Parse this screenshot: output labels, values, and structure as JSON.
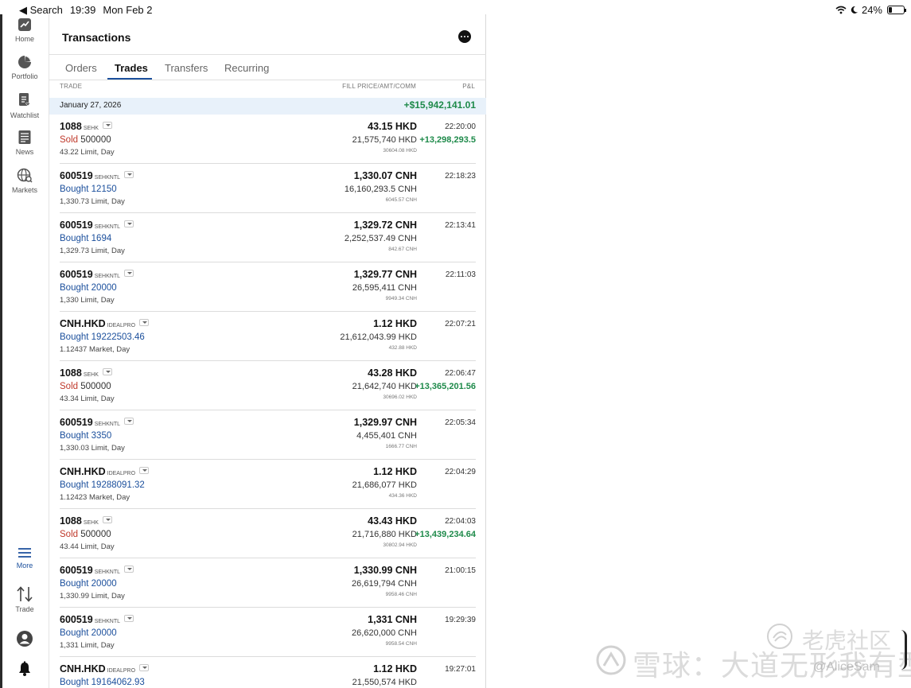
{
  "status_bar": {
    "back_label": "◀ Search",
    "time": "19:39",
    "date": "Mon Feb 2",
    "battery_text": "24%",
    "battery_level": 0.24
  },
  "sidebar": {
    "items": [
      {
        "label": "Home",
        "icon": "chart-trend-icon"
      },
      {
        "label": "Portfolio",
        "icon": "pie-chart-icon"
      },
      {
        "label": "Watchlist",
        "icon": "watchlist-icon"
      },
      {
        "label": "News",
        "icon": "news-icon"
      },
      {
        "label": "Markets",
        "icon": "globe-icon"
      }
    ],
    "bottom": [
      {
        "label": "More",
        "icon": "menu-icon"
      },
      {
        "label": "Trade",
        "icon": "trade-arrows-icon"
      },
      {
        "label": "",
        "icon": "account-icon"
      },
      {
        "label": "",
        "icon": "bell-icon"
      }
    ]
  },
  "header": {
    "title": "Transactions",
    "more_icon": "ellipsis-icon"
  },
  "tabs": [
    {
      "label": "Orders",
      "active": false
    },
    {
      "label": "Trades",
      "active": true
    },
    {
      "label": "Transfers",
      "active": false
    },
    {
      "label": "Recurring",
      "active": false
    }
  ],
  "columns": {
    "trade": "TRADE",
    "fill": "FILL PRICE/AMT/COMM",
    "pnl": "P&L"
  },
  "day_group": {
    "date": "January 27, 2026",
    "pnl": "+$15,942,141.01"
  },
  "trades": [
    {
      "symbol": "1088",
      "exchange": "SEHK",
      "action": "Sold",
      "qty": "500000",
      "order": "43.22 Limit, Day",
      "price": "43.15 HKD",
      "amount": "21,575,740 HKD",
      "commission": "30604.08 HKD",
      "time": "22:20:00",
      "pnl": "+13,298,293.5"
    },
    {
      "symbol": "600519",
      "exchange": "SEHKNTL",
      "action": "Bought",
      "qty": "12150",
      "order": "1,330.73 Limit, Day",
      "price": "1,330.07 CNH",
      "amount": "16,160,293.5 CNH",
      "commission": "6045.57 CNH",
      "time": "22:18:23",
      "pnl": ""
    },
    {
      "symbol": "600519",
      "exchange": "SEHKNTL",
      "action": "Bought",
      "qty": "1694",
      "order": "1,329.73 Limit, Day",
      "price": "1,329.72 CNH",
      "amount": "2,252,537.49 CNH",
      "commission": "842.67 CNH",
      "time": "22:13:41",
      "pnl": ""
    },
    {
      "symbol": "600519",
      "exchange": "SEHKNTL",
      "action": "Bought",
      "qty": "20000",
      "order": "1,330 Limit, Day",
      "price": "1,329.77 CNH",
      "amount": "26,595,411 CNH",
      "commission": "9949.34 CNH",
      "time": "22:11:03",
      "pnl": ""
    },
    {
      "symbol": "CNH.HKD",
      "exchange": "IDEALPRO",
      "action": "Bought",
      "qty": "19222503.46",
      "order": "1.12437 Market, Day",
      "price": "1.12 HKD",
      "amount": "21,612,043.99 HKD",
      "commission": "432.88 HKD",
      "time": "22:07:21",
      "pnl": ""
    },
    {
      "symbol": "1088",
      "exchange": "SEHK",
      "action": "Sold",
      "qty": "500000",
      "order": "43.34 Limit, Day",
      "price": "43.28 HKD",
      "amount": "21,642,740 HKD",
      "commission": "30696.02 HKD",
      "time": "22:06:47",
      "pnl": "+13,365,201.56"
    },
    {
      "symbol": "600519",
      "exchange": "SEHKNTL",
      "action": "Bought",
      "qty": "3350",
      "order": "1,330.03 Limit, Day",
      "price": "1,329.97 CNH",
      "amount": "4,455,401 CNH",
      "commission": "1666.77 CNH",
      "time": "22:05:34",
      "pnl": ""
    },
    {
      "symbol": "CNH.HKD",
      "exchange": "IDEALPRO",
      "action": "Bought",
      "qty": "19288091.32",
      "order": "1.12423 Market, Day",
      "price": "1.12 HKD",
      "amount": "21,686,077 HKD",
      "commission": "434.36 HKD",
      "time": "22:04:29",
      "pnl": ""
    },
    {
      "symbol": "1088",
      "exchange": "SEHK",
      "action": "Sold",
      "qty": "500000",
      "order": "43.44 Limit, Day",
      "price": "43.43 HKD",
      "amount": "21,716,880 HKD",
      "commission": "30802.94 HKD",
      "time": "22:04:03",
      "pnl": "+13,439,234.64"
    },
    {
      "symbol": "600519",
      "exchange": "SEHKNTL",
      "action": "Bought",
      "qty": "20000",
      "order": "1,330.99 Limit, Day",
      "price": "1,330.99 CNH",
      "amount": "26,619,794 CNH",
      "commission": "9958.46 CNH",
      "time": "21:00:15",
      "pnl": ""
    },
    {
      "symbol": "600519",
      "exchange": "SEHKNTL",
      "action": "Bought",
      "qty": "20000",
      "order": "1,331 Limit, Day",
      "price": "1,331 CNH",
      "amount": "26,620,000 CNH",
      "commission": "9958.54 CNH",
      "time": "19:29:39",
      "pnl": ""
    },
    {
      "symbol": "CNH.HKD",
      "exchange": "IDEALPRO",
      "action": "Bought",
      "qty": "19164062.93",
      "order": "",
      "price": "1.12 HKD",
      "amount": "21,550,574 HKD",
      "commission": "",
      "time": "19:27:01",
      "pnl": ""
    }
  ],
  "watermark": {
    "line1": "老虎社区",
    "line2": "雪球：大道无形我有型",
    "user": "@AliceSam"
  }
}
